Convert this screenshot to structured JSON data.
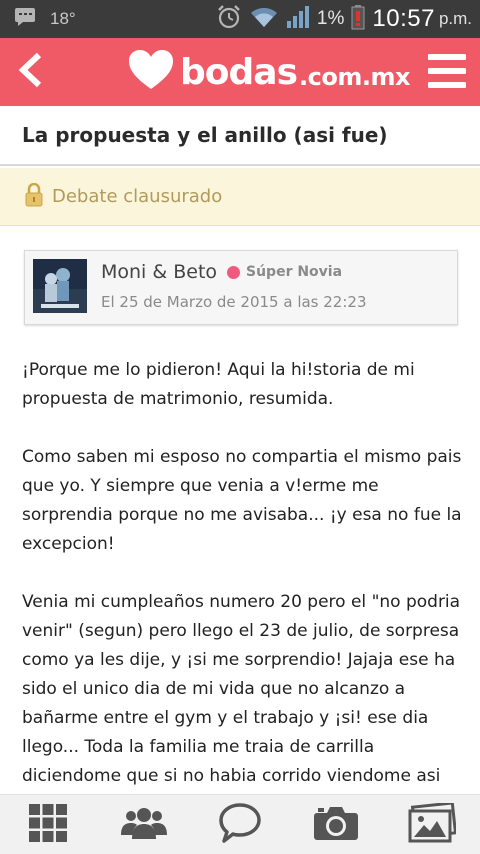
{
  "status_bar": {
    "temperature": "18°",
    "battery_percent": "1%",
    "time": "10:57",
    "ampm": "p.m."
  },
  "app_bar": {
    "logo_text": "bodas",
    "logo_tld": ".com.mx"
  },
  "thread": {
    "title": "La propuesta y el anillo (asi fue)",
    "status_notice": "Debate clausurado"
  },
  "author": {
    "name": "Moni & Beto",
    "badge": "Súper Novia",
    "date": "El 25 de Marzo de 2015 a las 22:23"
  },
  "post": {
    "paragraphs": [
      "¡Porque me lo pidieron! Aqui la hi!storia de mi propuesta de matrimonio, resumida.",
      "Como saben mi esposo no compartia el mismo pais que yo. Y siempre que venia a v!erme me sorprendia porque no me avisaba... ¡y esa no fue la excepcion!",
      "Venia mi cumpleaños numero 20 pero el \"no podria venir\" (segun) pero llego el 23 de julio, de sorpresa como ya les dije, y ¡si me sorprendio! Jajaja ese ha sido el unico dia de mi vida que no alcanzo a bañarme entre el gym y el trabajo y ¡si! ese dia llego... Toda la familia me traia de carrilla diciendome que si no habia corrido viendome asi de desalineada ¡nunca iba a correr!"
    ]
  },
  "bottom_nav": {
    "items": [
      "grid-icon",
      "people-icon",
      "chat-icon",
      "camera-icon",
      "photos-icon"
    ]
  },
  "colors": {
    "brand": "#f05a67",
    "notice_bg": "#fbf5dc",
    "notice_text": "#b29a5c",
    "badge_dot": "#f05a7e"
  }
}
